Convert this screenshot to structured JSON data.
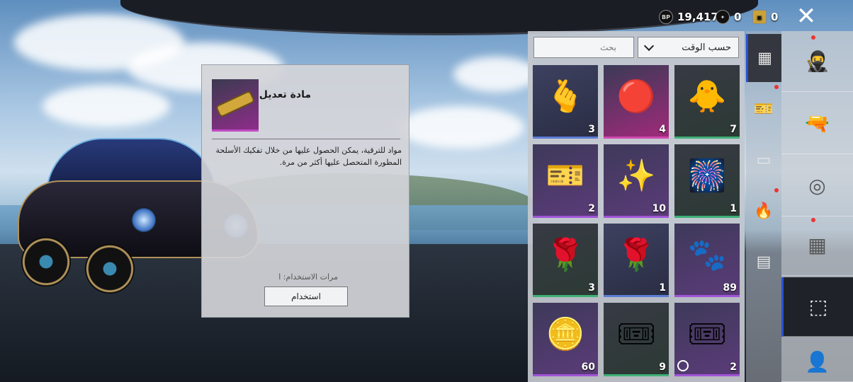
{
  "currency": [
    {
      "icon": "bp-coin-icon",
      "icon_text": "BP",
      "value": "19,417"
    },
    {
      "icon": "silver-fragment-icon",
      "icon_text": "",
      "value": "0"
    },
    {
      "icon": "coupon-icon",
      "icon_text": "",
      "value": "0"
    }
  ],
  "detail": {
    "title": "مادة تعديل",
    "description": "مواد للترقية، يمكن الحصول عليها من خلال تفكيك الأسلحة المطورة المتحصل عليها أكثر من مرة.",
    "uses_label": "مرات الاستخدام: ا",
    "use_button": "استخدام"
  },
  "inventory": {
    "search_placeholder": "بحث",
    "sort_label": "حسب الوقت",
    "items": [
      {
        "name": "heart-gesture",
        "glyph": "🫰",
        "count": "3",
        "rarity": "normal"
      },
      {
        "name": "red-crystal",
        "glyph": "🔴",
        "count": "4",
        "rarity": "pink"
      },
      {
        "name": "chicken-emote",
        "glyph": "🐥",
        "count": "7",
        "rarity": "green"
      },
      {
        "name": "x2-card",
        "glyph": "🎫",
        "count": "2",
        "rarity": "purple"
      },
      {
        "name": "magic-wand",
        "glyph": "✨",
        "count": "10",
        "rarity": "purple"
      },
      {
        "name": "firework",
        "glyph": "🎆",
        "count": "1",
        "rarity": "green"
      },
      {
        "name": "single-rose",
        "glyph": "🌹",
        "count": "3",
        "rarity": "green"
      },
      {
        "name": "rose-bouquet",
        "glyph": "🌹",
        "count": "1",
        "rarity": "normal"
      },
      {
        "name": "paw-coin",
        "glyph": "🐾",
        "count": "89",
        "rarity": "purple"
      },
      {
        "name": "gold-coin",
        "glyph": "🪙",
        "count": "60",
        "rarity": "purple"
      },
      {
        "name": "wow-ticket",
        "glyph": "🎟",
        "count": "9",
        "rarity": "green"
      },
      {
        "name": "discount-coupon",
        "glyph": "🎟",
        "count": "2",
        "rarity": "purple"
      }
    ]
  },
  "colors": {
    "accent_blue": "#2a4fd0",
    "rarity_purple": "#a055d6",
    "rarity_green": "#3fb076",
    "rarity_pink": "#d04ab0"
  }
}
